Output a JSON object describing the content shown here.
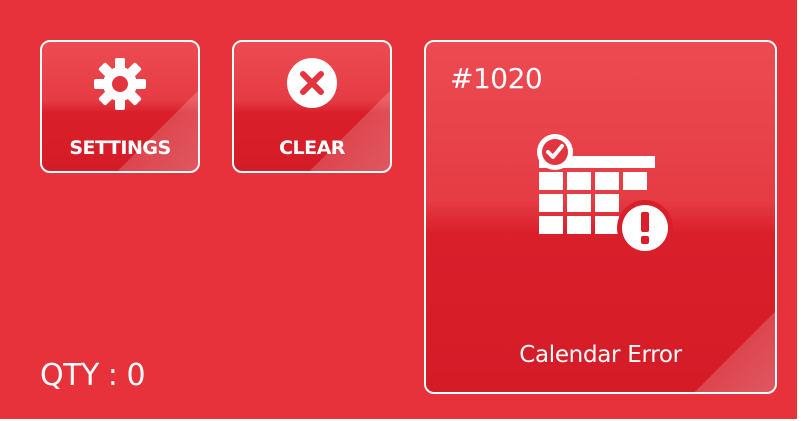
{
  "settings_tile": {
    "label": "SETTINGS",
    "icon": "gear-icon"
  },
  "clear_tile": {
    "label": "CLEAR",
    "icon": "close-circle-icon"
  },
  "order_tile": {
    "number": "#1020",
    "status": "Calendar Error",
    "icon": "calendar-error-icon"
  },
  "qty_label": "QTY : 0",
  "colors": {
    "background": "#e8323b",
    "tile_border": "#ffffff",
    "text": "#ffffff"
  }
}
